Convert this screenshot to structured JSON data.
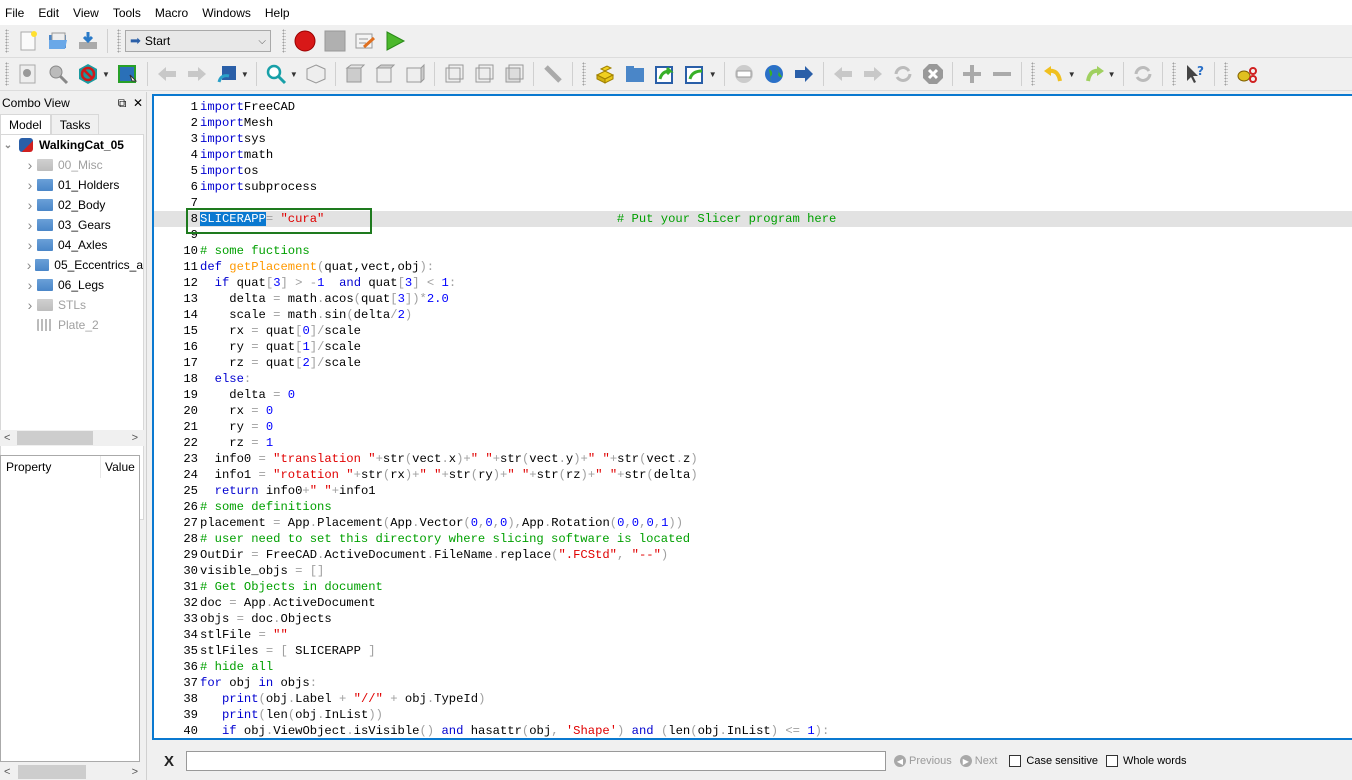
{
  "menu": [
    "File",
    "Edit",
    "View",
    "Tools",
    "Macro",
    "Windows",
    "Help"
  ],
  "toolbar1": {
    "icons": [
      "new-document-icon",
      "open-folder-icon",
      "save-icon"
    ],
    "workbench_select": {
      "value": "Start",
      "icon": "arrow-right-icon"
    },
    "macro_icons": [
      "record-macro-icon",
      "stop-macro-icon",
      "edit-macro-icon",
      "run-macro-icon"
    ]
  },
  "toolbar2": {
    "icons": [
      "fit-all-icon",
      "fit-selection-icon",
      "draw-style-icon",
      "bounding-box-icon",
      "back-icon",
      "forward-icon",
      "sync-view-icon",
      "zoom-icon",
      "isometric-icon",
      "front-view-icon",
      "top-view-icon",
      "right-view-icon",
      "rear-view-icon",
      "bottom-view-icon",
      "left-view-icon",
      "measure-icon",
      "part-icon",
      "group-icon",
      "link-icon",
      "link-actions-icon",
      "web-home-icon",
      "web-globe-icon",
      "web-go-icon",
      "web-back-icon",
      "web-forward-icon",
      "web-refresh-icon",
      "web-stop-icon",
      "zoom-in-icon",
      "zoom-out-icon",
      "undo-icon",
      "redo-icon",
      "refresh-icon",
      "whats-this-icon",
      "addon-icon"
    ]
  },
  "combo_view": {
    "title": "Combo View",
    "tabs": [
      "Model",
      "Tasks"
    ],
    "active_tab": "Model",
    "document": "WalkingCat_05",
    "tree": [
      {
        "label": "00_Misc",
        "type": "folder",
        "dim": true
      },
      {
        "label": "01_Holders",
        "type": "folder",
        "dim": false
      },
      {
        "label": "02_Body",
        "type": "folder",
        "dim": false
      },
      {
        "label": "03_Gears",
        "type": "folder",
        "dim": false
      },
      {
        "label": "04_Axles",
        "type": "folder",
        "dim": false
      },
      {
        "label": "05_Eccentrics_a",
        "type": "folder",
        "dim": false
      },
      {
        "label": "06_Legs",
        "type": "folder",
        "dim": false
      },
      {
        "label": "STLs",
        "type": "folder",
        "dim": true
      },
      {
        "label": "Plate_2",
        "type": "part",
        "dim": true
      }
    ],
    "property_headers": [
      "Property",
      "Value"
    ]
  },
  "editor": {
    "current_line": 8,
    "selected_text": "SLICERAPP",
    "lines": [
      [
        [
          "kw",
          "import"
        ],
        [
          "",
          "FreeCAD"
        ]
      ],
      [
        [
          "kw",
          "import"
        ],
        [
          "",
          "Mesh"
        ]
      ],
      [
        [
          "kw",
          "import"
        ],
        [
          "",
          "sys"
        ]
      ],
      [
        [
          "kw",
          "import"
        ],
        [
          "",
          "math"
        ]
      ],
      [
        [
          "kw",
          "import"
        ],
        [
          "",
          "os"
        ]
      ],
      [
        [
          "kw",
          "import"
        ],
        [
          "",
          "subprocess"
        ]
      ],
      [],
      [
        [
          "sel",
          "SLICERAPP"
        ],
        [
          "op",
          "= "
        ],
        [
          "str",
          "\"cura\""
        ],
        [
          "",
          "                                        "
        ],
        [
          "cm",
          "# Put your Slicer program here"
        ]
      ],
      [],
      [
        [
          "cm",
          "# some fuctions"
        ]
      ],
      [
        [
          "kw",
          "def "
        ],
        [
          "fn",
          "getPlacement"
        ],
        [
          "op",
          "("
        ],
        [
          "",
          "quat,vect,obj"
        ],
        [
          "op",
          "):"
        ]
      ],
      [
        [
          "",
          "  "
        ],
        [
          "kw",
          "if"
        ],
        [
          "",
          " quat"
        ],
        [
          "op",
          "["
        ],
        [
          "num",
          "3"
        ],
        [
          "op",
          "] > -"
        ],
        [
          "num",
          "1"
        ],
        [
          "",
          "  "
        ],
        [
          "kw",
          "and"
        ],
        [
          "",
          " quat"
        ],
        [
          "op",
          "["
        ],
        [
          "num",
          "3"
        ],
        [
          "op",
          "] < "
        ],
        [
          "num",
          "1"
        ],
        [
          "op",
          ":"
        ]
      ],
      [
        [
          "",
          "    delta "
        ],
        [
          "op",
          "="
        ],
        [
          "",
          " math"
        ],
        [
          "op",
          "."
        ],
        [
          "",
          "acos"
        ],
        [
          "op",
          "("
        ],
        [
          "",
          "quat"
        ],
        [
          "op",
          "["
        ],
        [
          "num",
          "3"
        ],
        [
          "op",
          "])*"
        ],
        [
          "num",
          "2.0"
        ]
      ],
      [
        [
          "",
          "    scale "
        ],
        [
          "op",
          "="
        ],
        [
          "",
          " math"
        ],
        [
          "op",
          "."
        ],
        [
          "",
          "sin"
        ],
        [
          "op",
          "("
        ],
        [
          "",
          "delta"
        ],
        [
          "op",
          "/"
        ],
        [
          "num",
          "2"
        ],
        [
          "op",
          ")"
        ]
      ],
      [
        [
          "",
          "    rx "
        ],
        [
          "op",
          "="
        ],
        [
          "",
          " quat"
        ],
        [
          "op",
          "["
        ],
        [
          "num",
          "0"
        ],
        [
          "op",
          "]/"
        ],
        [
          "",
          "scale"
        ]
      ],
      [
        [
          "",
          "    ry "
        ],
        [
          "op",
          "="
        ],
        [
          "",
          " quat"
        ],
        [
          "op",
          "["
        ],
        [
          "num",
          "1"
        ],
        [
          "op",
          "]/"
        ],
        [
          "",
          "scale"
        ]
      ],
      [
        [
          "",
          "    rz "
        ],
        [
          "op",
          "="
        ],
        [
          "",
          " quat"
        ],
        [
          "op",
          "["
        ],
        [
          "num",
          "2"
        ],
        [
          "op",
          "]/"
        ],
        [
          "",
          "scale"
        ]
      ],
      [
        [
          "",
          "  "
        ],
        [
          "kw",
          "else"
        ],
        [
          "op",
          ":"
        ]
      ],
      [
        [
          "",
          "    delta "
        ],
        [
          "op",
          "= "
        ],
        [
          "num",
          "0"
        ]
      ],
      [
        [
          "",
          "    rx "
        ],
        [
          "op",
          "= "
        ],
        [
          "num",
          "0"
        ]
      ],
      [
        [
          "",
          "    ry "
        ],
        [
          "op",
          "= "
        ],
        [
          "num",
          "0"
        ]
      ],
      [
        [
          "",
          "    rz "
        ],
        [
          "op",
          "= "
        ],
        [
          "num",
          "1"
        ]
      ],
      [
        [
          "",
          "  info0 "
        ],
        [
          "op",
          "= "
        ],
        [
          "str",
          "\"translation \""
        ],
        [
          "op",
          "+"
        ],
        [
          "",
          "str"
        ],
        [
          "op",
          "("
        ],
        [
          "",
          "vect"
        ],
        [
          "op",
          "."
        ],
        [
          "",
          "x"
        ],
        [
          "op",
          ")+"
        ],
        [
          "str",
          "\" \""
        ],
        [
          "op",
          "+"
        ],
        [
          "",
          "str"
        ],
        [
          "op",
          "("
        ],
        [
          "",
          "vect"
        ],
        [
          "op",
          "."
        ],
        [
          "",
          "y"
        ],
        [
          "op",
          ")+"
        ],
        [
          "str",
          "\" \""
        ],
        [
          "op",
          "+"
        ],
        [
          "",
          "str"
        ],
        [
          "op",
          "("
        ],
        [
          "",
          "vect"
        ],
        [
          "op",
          "."
        ],
        [
          "",
          "z"
        ],
        [
          "op",
          ")"
        ]
      ],
      [
        [
          "",
          "  info1 "
        ],
        [
          "op",
          "= "
        ],
        [
          "str",
          "\"rotation \""
        ],
        [
          "op",
          "+"
        ],
        [
          "",
          "str"
        ],
        [
          "op",
          "("
        ],
        [
          "",
          "rx"
        ],
        [
          "op",
          ")+"
        ],
        [
          "str",
          "\" \""
        ],
        [
          "op",
          "+"
        ],
        [
          "",
          "str"
        ],
        [
          "op",
          "("
        ],
        [
          "",
          "ry"
        ],
        [
          "op",
          ")+"
        ],
        [
          "str",
          "\" \""
        ],
        [
          "op",
          "+"
        ],
        [
          "",
          "str"
        ],
        [
          "op",
          "("
        ],
        [
          "",
          "rz"
        ],
        [
          "op",
          ")+"
        ],
        [
          "str",
          "\" \""
        ],
        [
          "op",
          "+"
        ],
        [
          "",
          "str"
        ],
        [
          "op",
          "("
        ],
        [
          "",
          "delta"
        ],
        [
          "op",
          ")"
        ]
      ],
      [
        [
          "",
          "  "
        ],
        [
          "kw",
          "return"
        ],
        [
          "",
          " info0"
        ],
        [
          "op",
          "+"
        ],
        [
          "str",
          "\" \""
        ],
        [
          "op",
          "+"
        ],
        [
          "",
          "info1"
        ]
      ],
      [
        [
          "cm",
          "# some definitions"
        ]
      ],
      [
        [
          "",
          "placement "
        ],
        [
          "op",
          "= "
        ],
        [
          "",
          "App"
        ],
        [
          "op",
          "."
        ],
        [
          "",
          "Placement"
        ],
        [
          "op",
          "("
        ],
        [
          "",
          "App"
        ],
        [
          "op",
          "."
        ],
        [
          "",
          "Vector"
        ],
        [
          "op",
          "("
        ],
        [
          "num",
          "0"
        ],
        [
          "op",
          ","
        ],
        [
          "num",
          "0"
        ],
        [
          "op",
          ","
        ],
        [
          "num",
          "0"
        ],
        [
          "op",
          "),"
        ],
        [
          "",
          "App"
        ],
        [
          "op",
          "."
        ],
        [
          "",
          "Rotation"
        ],
        [
          "op",
          "("
        ],
        [
          "num",
          "0"
        ],
        [
          "op",
          ","
        ],
        [
          "num",
          "0"
        ],
        [
          "op",
          ","
        ],
        [
          "num",
          "0"
        ],
        [
          "op",
          ","
        ],
        [
          "num",
          "1"
        ],
        [
          "op",
          "))"
        ]
      ],
      [
        [
          "cm",
          "# user need to set this directory where slicing software is located"
        ]
      ],
      [
        [
          "",
          "OutDir "
        ],
        [
          "op",
          "= "
        ],
        [
          "",
          "FreeCAD"
        ],
        [
          "op",
          "."
        ],
        [
          "",
          "ActiveDocument"
        ],
        [
          "op",
          "."
        ],
        [
          "",
          "FileName"
        ],
        [
          "op",
          "."
        ],
        [
          "",
          "replace"
        ],
        [
          "op",
          "("
        ],
        [
          "str",
          "\".FCStd\""
        ],
        [
          "op",
          ", "
        ],
        [
          "str",
          "\"--\""
        ],
        [
          "op",
          ")"
        ]
      ],
      [
        [
          "",
          "visible_objs "
        ],
        [
          "op",
          "= []"
        ]
      ],
      [
        [
          "cm",
          "# Get Objects in document"
        ]
      ],
      [
        [
          "",
          "doc "
        ],
        [
          "op",
          "= "
        ],
        [
          "",
          "App"
        ],
        [
          "op",
          "."
        ],
        [
          "",
          "ActiveDocument"
        ]
      ],
      [
        [
          "",
          "objs "
        ],
        [
          "op",
          "= "
        ],
        [
          "",
          "doc"
        ],
        [
          "op",
          "."
        ],
        [
          "",
          "Objects"
        ]
      ],
      [
        [
          "",
          "stlFile "
        ],
        [
          "op",
          "= "
        ],
        [
          "str",
          "\"\""
        ]
      ],
      [
        [
          "",
          "stlFiles "
        ],
        [
          "op",
          "= [ "
        ],
        [
          "",
          "SLICERAPP "
        ],
        [
          "op",
          "]"
        ]
      ],
      [
        [
          "cm",
          "# hide all"
        ]
      ],
      [
        [
          "kw",
          "for"
        ],
        [
          "",
          " obj "
        ],
        [
          "kw",
          "in"
        ],
        [
          "",
          " objs"
        ],
        [
          "op",
          ":"
        ]
      ],
      [
        [
          "",
          "   "
        ],
        [
          "kw",
          "print"
        ],
        [
          "op",
          "("
        ],
        [
          "",
          "obj"
        ],
        [
          "op",
          "."
        ],
        [
          "",
          "Label "
        ],
        [
          "op",
          "+ "
        ],
        [
          "str",
          "\"//\""
        ],
        [
          "op",
          " + "
        ],
        [
          "",
          "obj"
        ],
        [
          "op",
          "."
        ],
        [
          "",
          "TypeId"
        ],
        [
          "op",
          ")"
        ]
      ],
      [
        [
          "",
          "   "
        ],
        [
          "kw",
          "print"
        ],
        [
          "op",
          "("
        ],
        [
          "",
          "len"
        ],
        [
          "op",
          "("
        ],
        [
          "",
          "obj"
        ],
        [
          "op",
          "."
        ],
        [
          "",
          "InList"
        ],
        [
          "op",
          "))"
        ]
      ],
      [
        [
          "",
          "   "
        ],
        [
          "kw",
          "if"
        ],
        [
          "",
          " obj"
        ],
        [
          "op",
          "."
        ],
        [
          "",
          "ViewObject"
        ],
        [
          "op",
          "."
        ],
        [
          "",
          "isVisible"
        ],
        [
          "op",
          "() "
        ],
        [
          "kw",
          "and"
        ],
        [
          "",
          " hasattr"
        ],
        [
          "op",
          "("
        ],
        [
          "",
          "obj"
        ],
        [
          "op",
          ", "
        ],
        [
          "str",
          "'Shape'"
        ],
        [
          "op",
          ") "
        ],
        [
          "kw",
          "and"
        ],
        [
          "",
          " "
        ],
        [
          "op",
          "("
        ],
        [
          "",
          "len"
        ],
        [
          "op",
          "("
        ],
        [
          "",
          "obj"
        ],
        [
          "op",
          "."
        ],
        [
          "",
          "InList"
        ],
        [
          "op",
          ") <= "
        ],
        [
          "num",
          "1"
        ],
        [
          "op",
          "):"
        ]
      ]
    ]
  },
  "find_bar": {
    "close_label": "X",
    "input_value": "",
    "previous_label": "Previous",
    "next_label": "Next",
    "case_sensitive_label": "Case sensitive",
    "whole_words_label": "Whole words",
    "case_sensitive_checked": false,
    "whole_words_checked": false
  }
}
